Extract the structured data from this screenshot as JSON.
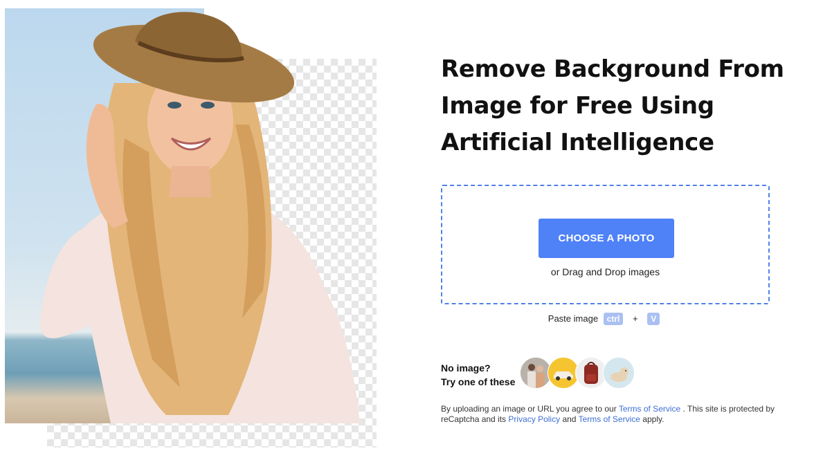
{
  "hero": {
    "image_alt": "Smiling woman in a straw hat with background partially removed"
  },
  "headline": {
    "line1": "Remove Background From",
    "line2": "Image for Free Using",
    "line3": "Artificial Intelligence"
  },
  "upload": {
    "button_label": "CHOOSE A PHOTO",
    "drop_text": "or Drag and Drop images"
  },
  "paste": {
    "label": "Paste image",
    "key1": "ctrl",
    "plus": "+",
    "key2": "V"
  },
  "samples": {
    "line1": "No image?",
    "line2": "Try one of these",
    "items": [
      {
        "icon": "couple-photo"
      },
      {
        "icon": "car-photo"
      },
      {
        "icon": "backpack-photo"
      },
      {
        "icon": "dog-photo"
      }
    ]
  },
  "terms": {
    "prefix": "By uploading an image or URL you agree to our",
    "link1": "Terms of Service",
    "middle": ". This site is protected by reCaptcha and its",
    "link2": "Privacy Policy",
    "and": "and",
    "link3": "Terms of Service",
    "suffix": "apply."
  },
  "colors": {
    "accent": "#4f81f7",
    "dropzone_border": "#4f80e8",
    "link": "#3d6fd6",
    "key_badge": "#aac0f2"
  }
}
